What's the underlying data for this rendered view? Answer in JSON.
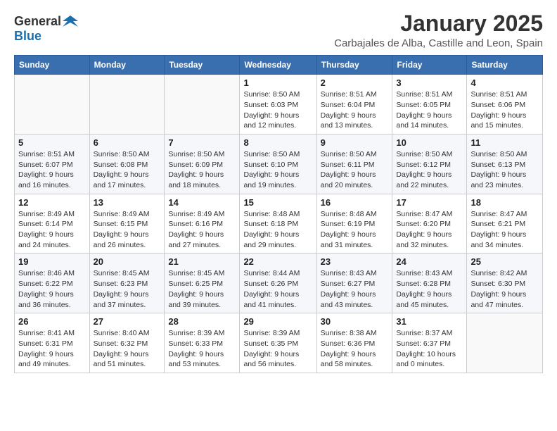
{
  "logo": {
    "general": "General",
    "blue": "Blue"
  },
  "title": "January 2025",
  "subtitle": "Carbajales de Alba, Castille and Leon, Spain",
  "weekdays": [
    "Sunday",
    "Monday",
    "Tuesday",
    "Wednesday",
    "Thursday",
    "Friday",
    "Saturday"
  ],
  "weeks": [
    [
      {
        "day": "",
        "detail": ""
      },
      {
        "day": "",
        "detail": ""
      },
      {
        "day": "",
        "detail": ""
      },
      {
        "day": "1",
        "detail": "Sunrise: 8:50 AM\nSunset: 6:03 PM\nDaylight: 9 hours\nand 12 minutes."
      },
      {
        "day": "2",
        "detail": "Sunrise: 8:51 AM\nSunset: 6:04 PM\nDaylight: 9 hours\nand 13 minutes."
      },
      {
        "day": "3",
        "detail": "Sunrise: 8:51 AM\nSunset: 6:05 PM\nDaylight: 9 hours\nand 14 minutes."
      },
      {
        "day": "4",
        "detail": "Sunrise: 8:51 AM\nSunset: 6:06 PM\nDaylight: 9 hours\nand 15 minutes."
      }
    ],
    [
      {
        "day": "5",
        "detail": "Sunrise: 8:51 AM\nSunset: 6:07 PM\nDaylight: 9 hours\nand 16 minutes."
      },
      {
        "day": "6",
        "detail": "Sunrise: 8:50 AM\nSunset: 6:08 PM\nDaylight: 9 hours\nand 17 minutes."
      },
      {
        "day": "7",
        "detail": "Sunrise: 8:50 AM\nSunset: 6:09 PM\nDaylight: 9 hours\nand 18 minutes."
      },
      {
        "day": "8",
        "detail": "Sunrise: 8:50 AM\nSunset: 6:10 PM\nDaylight: 9 hours\nand 19 minutes."
      },
      {
        "day": "9",
        "detail": "Sunrise: 8:50 AM\nSunset: 6:11 PM\nDaylight: 9 hours\nand 20 minutes."
      },
      {
        "day": "10",
        "detail": "Sunrise: 8:50 AM\nSunset: 6:12 PM\nDaylight: 9 hours\nand 22 minutes."
      },
      {
        "day": "11",
        "detail": "Sunrise: 8:50 AM\nSunset: 6:13 PM\nDaylight: 9 hours\nand 23 minutes."
      }
    ],
    [
      {
        "day": "12",
        "detail": "Sunrise: 8:49 AM\nSunset: 6:14 PM\nDaylight: 9 hours\nand 24 minutes."
      },
      {
        "day": "13",
        "detail": "Sunrise: 8:49 AM\nSunset: 6:15 PM\nDaylight: 9 hours\nand 26 minutes."
      },
      {
        "day": "14",
        "detail": "Sunrise: 8:49 AM\nSunset: 6:16 PM\nDaylight: 9 hours\nand 27 minutes."
      },
      {
        "day": "15",
        "detail": "Sunrise: 8:48 AM\nSunset: 6:18 PM\nDaylight: 9 hours\nand 29 minutes."
      },
      {
        "day": "16",
        "detail": "Sunrise: 8:48 AM\nSunset: 6:19 PM\nDaylight: 9 hours\nand 31 minutes."
      },
      {
        "day": "17",
        "detail": "Sunrise: 8:47 AM\nSunset: 6:20 PM\nDaylight: 9 hours\nand 32 minutes."
      },
      {
        "day": "18",
        "detail": "Sunrise: 8:47 AM\nSunset: 6:21 PM\nDaylight: 9 hours\nand 34 minutes."
      }
    ],
    [
      {
        "day": "19",
        "detail": "Sunrise: 8:46 AM\nSunset: 6:22 PM\nDaylight: 9 hours\nand 36 minutes."
      },
      {
        "day": "20",
        "detail": "Sunrise: 8:45 AM\nSunset: 6:23 PM\nDaylight: 9 hours\nand 37 minutes."
      },
      {
        "day": "21",
        "detail": "Sunrise: 8:45 AM\nSunset: 6:25 PM\nDaylight: 9 hours\nand 39 minutes."
      },
      {
        "day": "22",
        "detail": "Sunrise: 8:44 AM\nSunset: 6:26 PM\nDaylight: 9 hours\nand 41 minutes."
      },
      {
        "day": "23",
        "detail": "Sunrise: 8:43 AM\nSunset: 6:27 PM\nDaylight: 9 hours\nand 43 minutes."
      },
      {
        "day": "24",
        "detail": "Sunrise: 8:43 AM\nSunset: 6:28 PM\nDaylight: 9 hours\nand 45 minutes."
      },
      {
        "day": "25",
        "detail": "Sunrise: 8:42 AM\nSunset: 6:30 PM\nDaylight: 9 hours\nand 47 minutes."
      }
    ],
    [
      {
        "day": "26",
        "detail": "Sunrise: 8:41 AM\nSunset: 6:31 PM\nDaylight: 9 hours\nand 49 minutes."
      },
      {
        "day": "27",
        "detail": "Sunrise: 8:40 AM\nSunset: 6:32 PM\nDaylight: 9 hours\nand 51 minutes."
      },
      {
        "day": "28",
        "detail": "Sunrise: 8:39 AM\nSunset: 6:33 PM\nDaylight: 9 hours\nand 53 minutes."
      },
      {
        "day": "29",
        "detail": "Sunrise: 8:39 AM\nSunset: 6:35 PM\nDaylight: 9 hours\nand 56 minutes."
      },
      {
        "day": "30",
        "detail": "Sunrise: 8:38 AM\nSunset: 6:36 PM\nDaylight: 9 hours\nand 58 minutes."
      },
      {
        "day": "31",
        "detail": "Sunrise: 8:37 AM\nSunset: 6:37 PM\nDaylight: 10 hours\nand 0 minutes."
      },
      {
        "day": "",
        "detail": ""
      }
    ]
  ]
}
